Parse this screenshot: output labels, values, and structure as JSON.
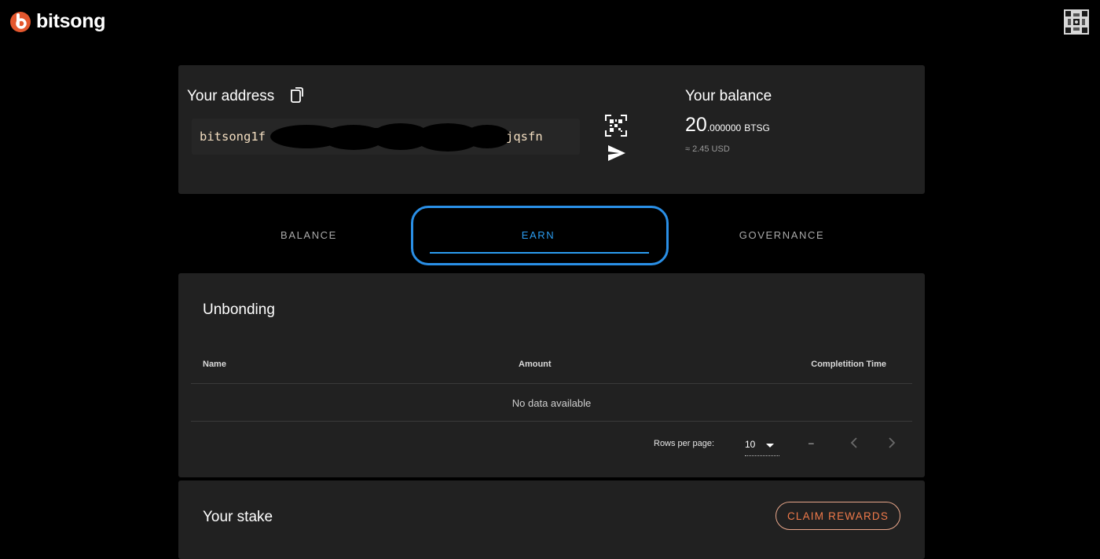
{
  "app": {
    "brand": "bitsong",
    "brand_color": "#e4572e"
  },
  "address": {
    "title": "Your address",
    "prefix": "bitsong1f",
    "suffix": "jqsfn",
    "redacted": true
  },
  "balance": {
    "title": "Your balance",
    "int": "20",
    "dec": ".000000",
    "unit": "BTSG",
    "usd": "≈ 2.45 USD"
  },
  "tabs": [
    {
      "label": "BALANCE"
    },
    {
      "label": "EARN",
      "active": true
    },
    {
      "label": "GOVERNANCE"
    }
  ],
  "unbonding": {
    "title": "Unbonding",
    "columns": [
      "Name",
      "Amount",
      "Completition Time"
    ],
    "empty": "No data available",
    "rows_per_page_label": "Rows per page:",
    "rows_per_page": "10",
    "range": "–"
  },
  "stake": {
    "title": "Your stake",
    "claim_label": "CLAIM REWARDS"
  },
  "icons": [
    "bitsong-logo-icon",
    "identicon-icon",
    "copy-icon",
    "qr-code-icon",
    "send-icon",
    "chevron-left-icon",
    "chevron-right-icon",
    "caret-down-icon"
  ],
  "colors": {
    "accent_blue": "#2b9cf0",
    "claim_orange": "#f07a4a",
    "card_bg": "#212121"
  }
}
